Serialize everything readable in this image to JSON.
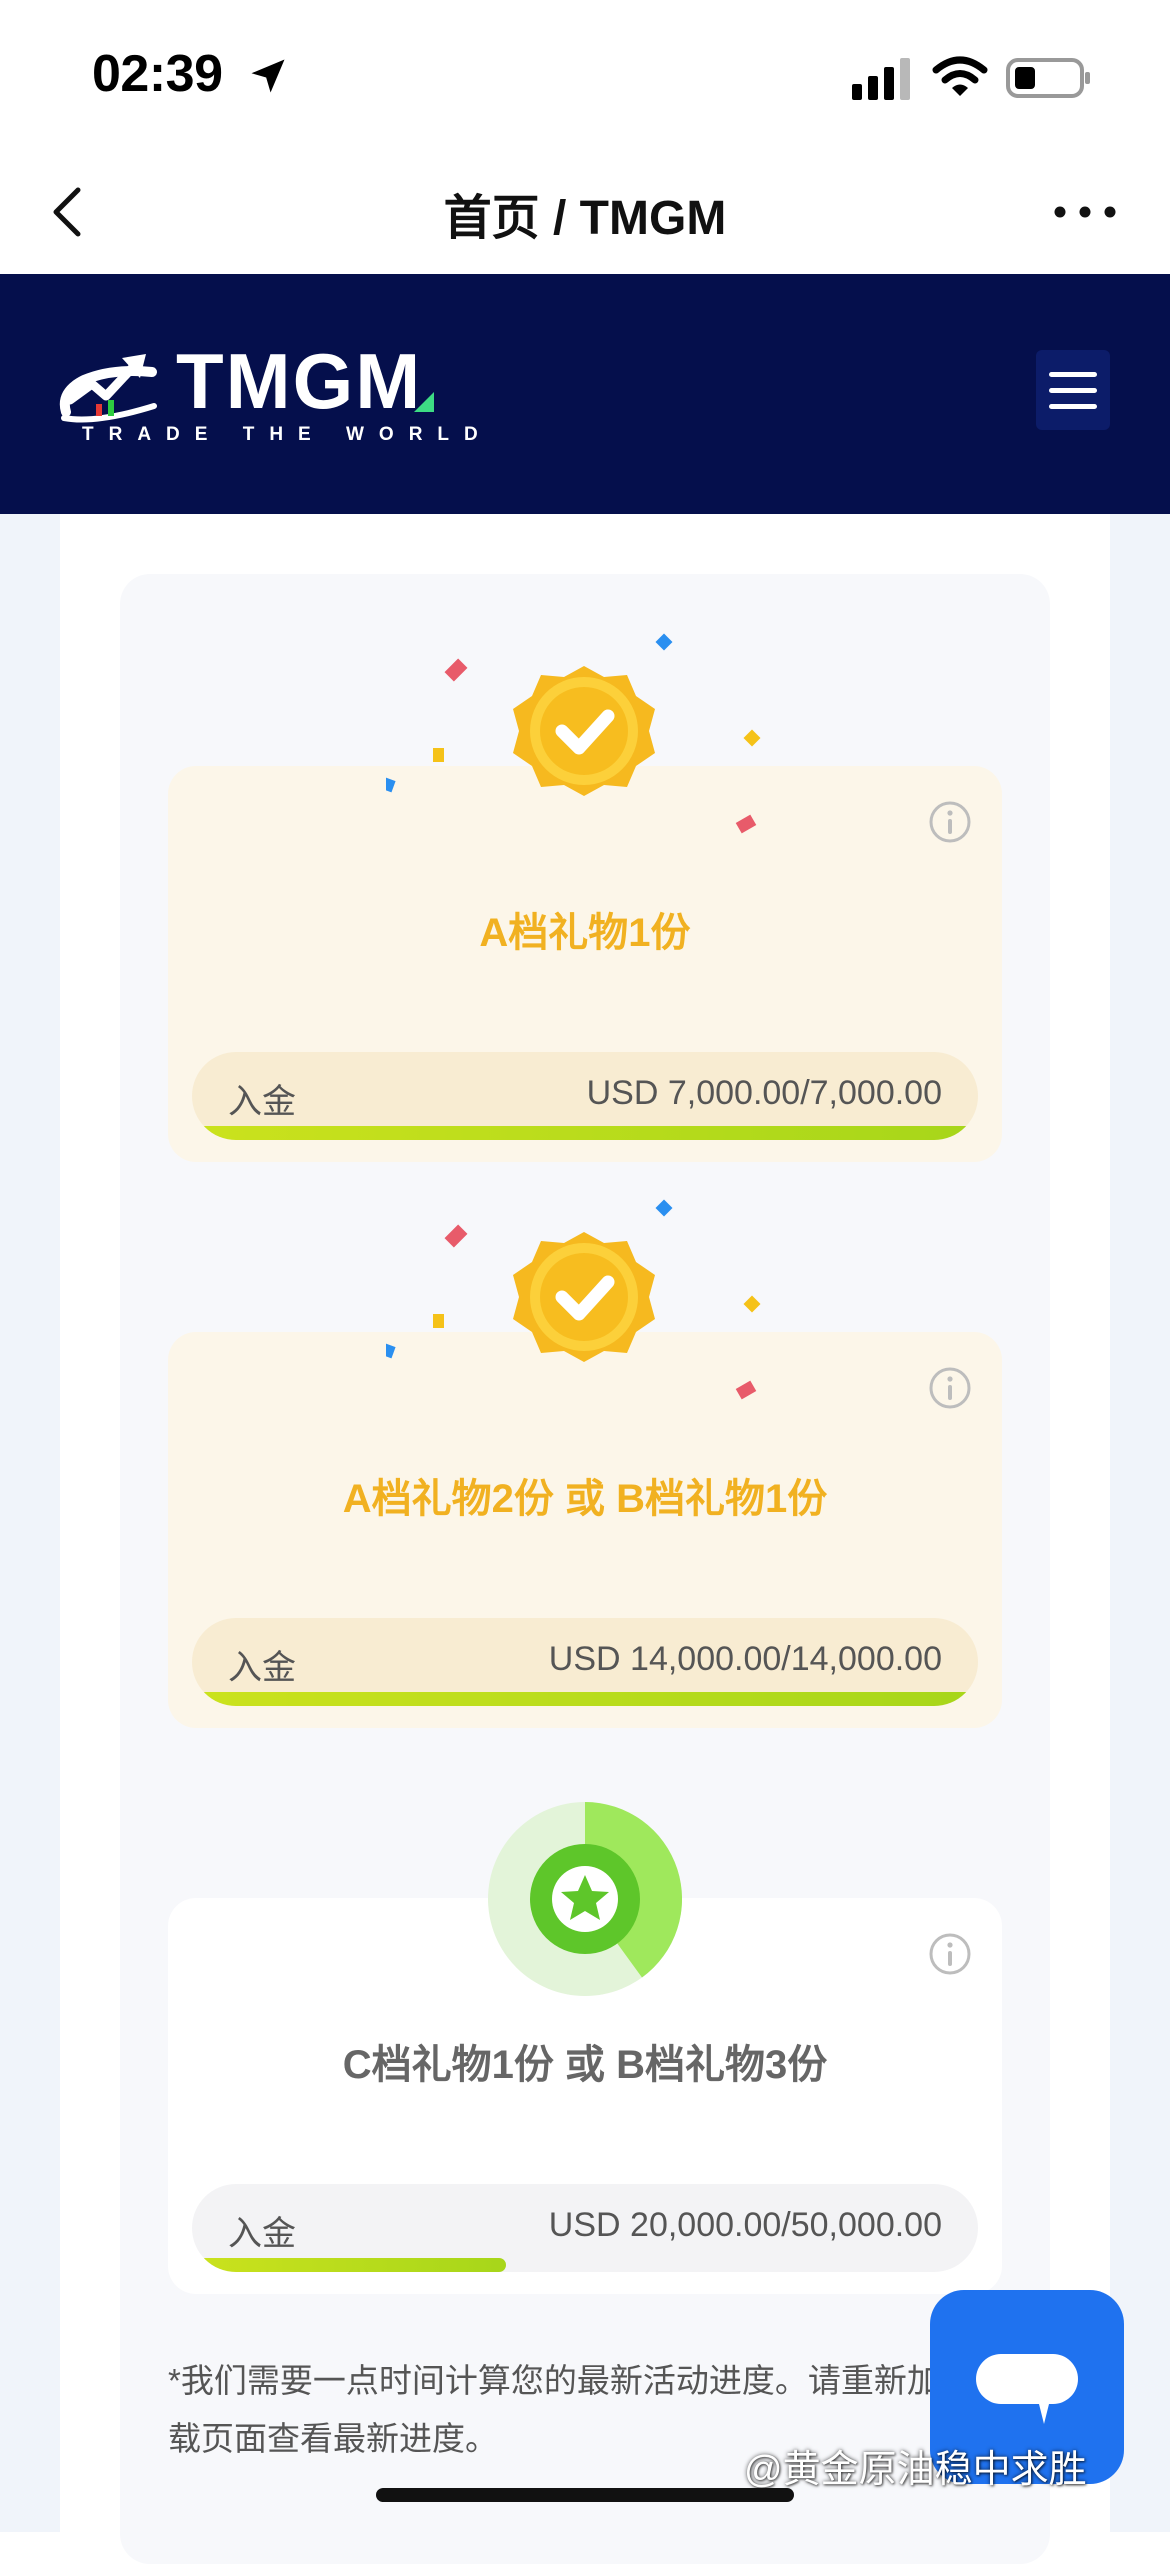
{
  "status_bar": {
    "time": "02:39",
    "icons": [
      "location-arrow-icon",
      "cellular-signal-icon",
      "wifi-icon",
      "battery-icon"
    ]
  },
  "nav": {
    "title": "首页 / TMGM",
    "icons": [
      "chevron-left-icon",
      "more-horizontal-icon"
    ]
  },
  "brand": {
    "logo_text": "TMGM",
    "tagline": "TRADE THE WORLD",
    "colors": {
      "bar_bg": "#050f4c",
      "menu_bg": "#0c1c69"
    },
    "icons": [
      "tmgm-logo-icon",
      "hamburger-menu-icon"
    ]
  },
  "tiers": [
    {
      "title": "A档礼物1份",
      "status": "completed",
      "progress_label": "入金",
      "progress_value": "USD 7,000.00/7,000.00",
      "progress": 1.0,
      "badge_icon": "completed-seal-check-icon"
    },
    {
      "title": "A档礼物2份 或 B档礼物1份",
      "status": "completed",
      "progress_label": "入金",
      "progress_value": "USD 14,000.00/14,000.00",
      "progress": 1.0,
      "badge_icon": "completed-seal-check-icon"
    },
    {
      "title": "C档礼物1份 或 B档礼物3份",
      "status": "in-progress",
      "progress_label": "入金",
      "progress_value": "USD 20,000.00/50,000.00",
      "progress": 0.4,
      "badge_icon": "star-progress-ring-icon"
    }
  ],
  "footnote": "*我们需要一点时间计算您的最新活动进度。请重新加载页面查看最新进度。",
  "chat": {
    "icon": "chat-bubble-icon",
    "color": "#1f72ef"
  },
  "watermark": "@黄金原油稳中求胜",
  "colors": {
    "accent_gold": "#f1b121",
    "progress_green": "#b6db1b",
    "completed_card_bg": "#fcf6e9"
  }
}
